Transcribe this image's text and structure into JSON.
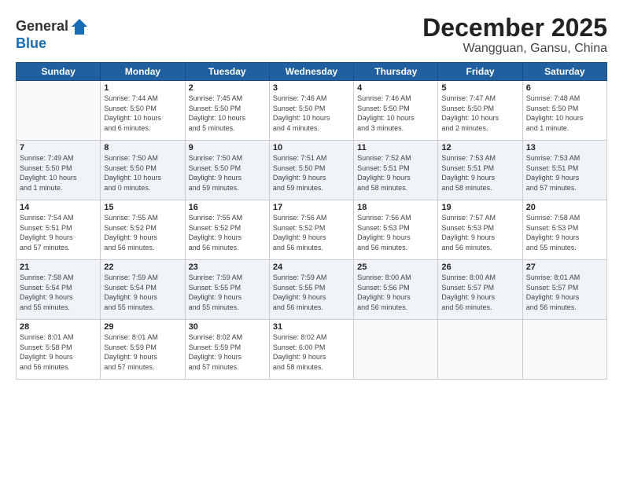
{
  "header": {
    "logo_general": "General",
    "logo_blue": "Blue",
    "month_title": "December 2025",
    "location": "Wangguan, Gansu, China"
  },
  "weekdays": [
    "Sunday",
    "Monday",
    "Tuesday",
    "Wednesday",
    "Thursday",
    "Friday",
    "Saturday"
  ],
  "weeks": [
    [
      {
        "day": "",
        "info": ""
      },
      {
        "day": "1",
        "info": "Sunrise: 7:44 AM\nSunset: 5:50 PM\nDaylight: 10 hours\nand 6 minutes."
      },
      {
        "day": "2",
        "info": "Sunrise: 7:45 AM\nSunset: 5:50 PM\nDaylight: 10 hours\nand 5 minutes."
      },
      {
        "day": "3",
        "info": "Sunrise: 7:46 AM\nSunset: 5:50 PM\nDaylight: 10 hours\nand 4 minutes."
      },
      {
        "day": "4",
        "info": "Sunrise: 7:46 AM\nSunset: 5:50 PM\nDaylight: 10 hours\nand 3 minutes."
      },
      {
        "day": "5",
        "info": "Sunrise: 7:47 AM\nSunset: 5:50 PM\nDaylight: 10 hours\nand 2 minutes."
      },
      {
        "day": "6",
        "info": "Sunrise: 7:48 AM\nSunset: 5:50 PM\nDaylight: 10 hours\nand 1 minute."
      }
    ],
    [
      {
        "day": "7",
        "info": "Sunrise: 7:49 AM\nSunset: 5:50 PM\nDaylight: 10 hours\nand 1 minute."
      },
      {
        "day": "8",
        "info": "Sunrise: 7:50 AM\nSunset: 5:50 PM\nDaylight: 10 hours\nand 0 minutes."
      },
      {
        "day": "9",
        "info": "Sunrise: 7:50 AM\nSunset: 5:50 PM\nDaylight: 9 hours\nand 59 minutes."
      },
      {
        "day": "10",
        "info": "Sunrise: 7:51 AM\nSunset: 5:50 PM\nDaylight: 9 hours\nand 59 minutes."
      },
      {
        "day": "11",
        "info": "Sunrise: 7:52 AM\nSunset: 5:51 PM\nDaylight: 9 hours\nand 58 minutes."
      },
      {
        "day": "12",
        "info": "Sunrise: 7:53 AM\nSunset: 5:51 PM\nDaylight: 9 hours\nand 58 minutes."
      },
      {
        "day": "13",
        "info": "Sunrise: 7:53 AM\nSunset: 5:51 PM\nDaylight: 9 hours\nand 57 minutes."
      }
    ],
    [
      {
        "day": "14",
        "info": "Sunrise: 7:54 AM\nSunset: 5:51 PM\nDaylight: 9 hours\nand 57 minutes."
      },
      {
        "day": "15",
        "info": "Sunrise: 7:55 AM\nSunset: 5:52 PM\nDaylight: 9 hours\nand 56 minutes."
      },
      {
        "day": "16",
        "info": "Sunrise: 7:55 AM\nSunset: 5:52 PM\nDaylight: 9 hours\nand 56 minutes."
      },
      {
        "day": "17",
        "info": "Sunrise: 7:56 AM\nSunset: 5:52 PM\nDaylight: 9 hours\nand 56 minutes."
      },
      {
        "day": "18",
        "info": "Sunrise: 7:56 AM\nSunset: 5:53 PM\nDaylight: 9 hours\nand 56 minutes."
      },
      {
        "day": "19",
        "info": "Sunrise: 7:57 AM\nSunset: 5:53 PM\nDaylight: 9 hours\nand 56 minutes."
      },
      {
        "day": "20",
        "info": "Sunrise: 7:58 AM\nSunset: 5:53 PM\nDaylight: 9 hours\nand 55 minutes."
      }
    ],
    [
      {
        "day": "21",
        "info": "Sunrise: 7:58 AM\nSunset: 5:54 PM\nDaylight: 9 hours\nand 55 minutes."
      },
      {
        "day": "22",
        "info": "Sunrise: 7:59 AM\nSunset: 5:54 PM\nDaylight: 9 hours\nand 55 minutes."
      },
      {
        "day": "23",
        "info": "Sunrise: 7:59 AM\nSunset: 5:55 PM\nDaylight: 9 hours\nand 55 minutes."
      },
      {
        "day": "24",
        "info": "Sunrise: 7:59 AM\nSunset: 5:55 PM\nDaylight: 9 hours\nand 56 minutes."
      },
      {
        "day": "25",
        "info": "Sunrise: 8:00 AM\nSunset: 5:56 PM\nDaylight: 9 hours\nand 56 minutes."
      },
      {
        "day": "26",
        "info": "Sunrise: 8:00 AM\nSunset: 5:57 PM\nDaylight: 9 hours\nand 56 minutes."
      },
      {
        "day": "27",
        "info": "Sunrise: 8:01 AM\nSunset: 5:57 PM\nDaylight: 9 hours\nand 56 minutes."
      }
    ],
    [
      {
        "day": "28",
        "info": "Sunrise: 8:01 AM\nSunset: 5:58 PM\nDaylight: 9 hours\nand 56 minutes."
      },
      {
        "day": "29",
        "info": "Sunrise: 8:01 AM\nSunset: 5:59 PM\nDaylight: 9 hours\nand 57 minutes."
      },
      {
        "day": "30",
        "info": "Sunrise: 8:02 AM\nSunset: 5:59 PM\nDaylight: 9 hours\nand 57 minutes."
      },
      {
        "day": "31",
        "info": "Sunrise: 8:02 AM\nSunset: 6:00 PM\nDaylight: 9 hours\nand 58 minutes."
      },
      {
        "day": "",
        "info": ""
      },
      {
        "day": "",
        "info": ""
      },
      {
        "day": "",
        "info": ""
      }
    ]
  ]
}
